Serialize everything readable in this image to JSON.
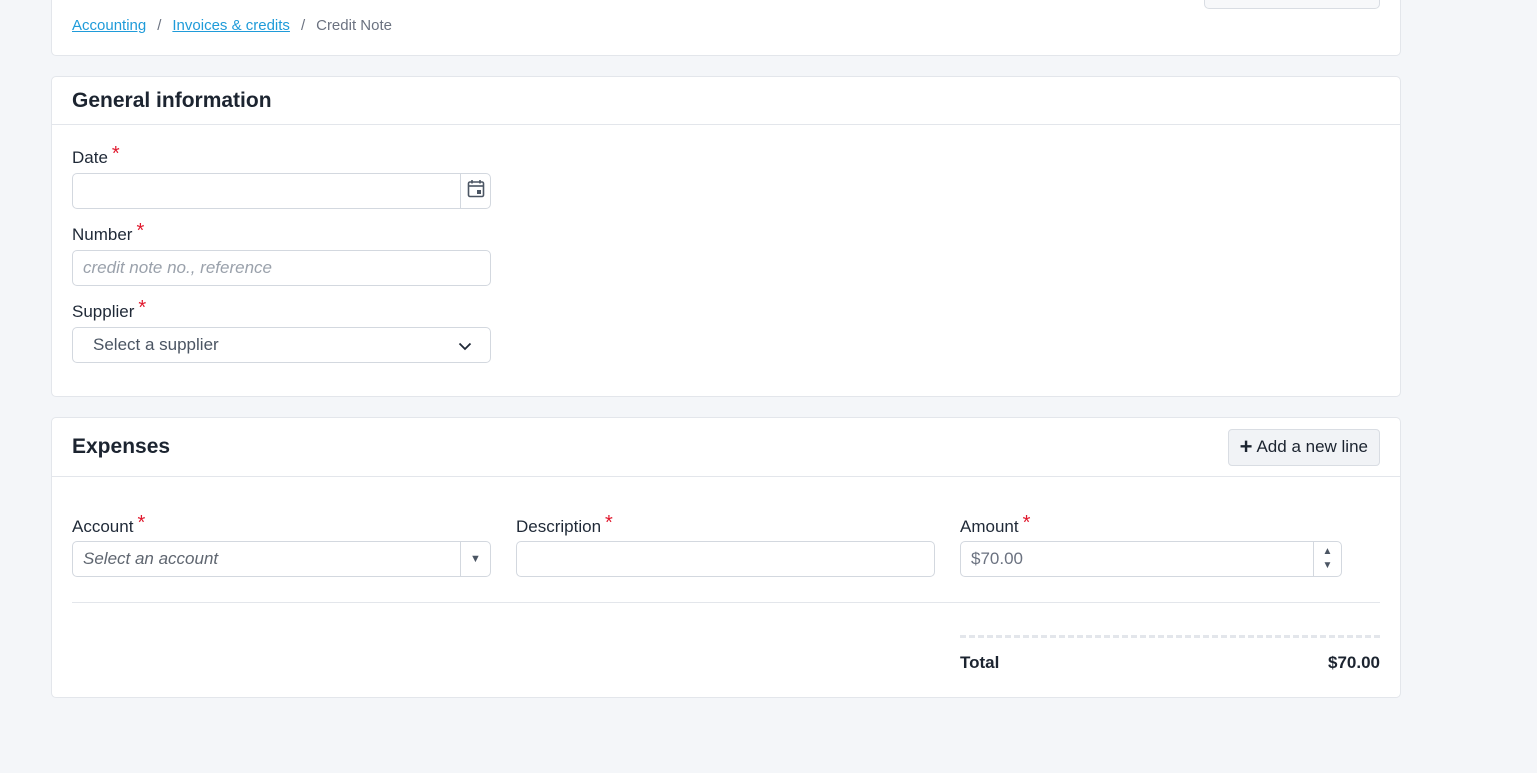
{
  "breadcrumb": {
    "items": [
      {
        "label": "Accounting"
      },
      {
        "label": "Invoices & credits"
      }
    ],
    "separator": "/",
    "current": "Credit Note"
  },
  "general": {
    "title": "General information",
    "date": {
      "label": "Date",
      "value": ""
    },
    "number": {
      "label": "Number",
      "placeholder": "credit note no., reference"
    },
    "supplier": {
      "label": "Supplier",
      "selected": "Select a supplier"
    }
  },
  "expenses": {
    "title": "Expenses",
    "add_line_label": "Add a new line",
    "account": {
      "label": "Account",
      "placeholder": "Select an account"
    },
    "description": {
      "label": "Description",
      "value": ""
    },
    "amount": {
      "label": "Amount",
      "value": "$70.00"
    },
    "total_label": "Total",
    "total_value": "$70.00"
  },
  "required_marker": "*",
  "colors": {
    "link": "#1f9bd9",
    "required": "#e0182d",
    "background": "#f4f6f9"
  }
}
